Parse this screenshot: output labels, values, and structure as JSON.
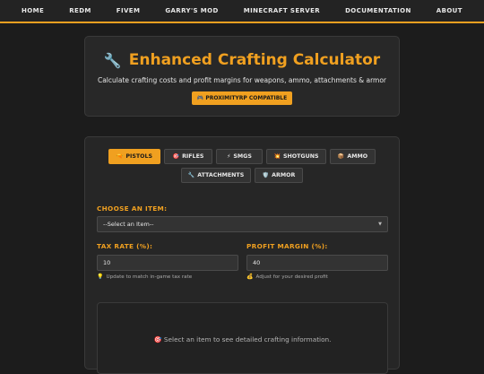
{
  "nav": {
    "items": [
      "HOME",
      "REDM",
      "FIVEM",
      "GARRY'S MOD",
      "MINECRAFT SERVER",
      "DOCUMENTATION",
      "ABOUT"
    ]
  },
  "hero": {
    "icon": "🔧",
    "title": "Enhanced Crafting Calculator",
    "subtitle": "Calculate crafting costs and profit margins for weapons, ammo, attachments & armor",
    "badge_icon": "🎮",
    "badge": "PROXIMITYRP COMPATIBLE"
  },
  "tabs": [
    {
      "icon": "🔫",
      "label": "PISTOLS",
      "active": true
    },
    {
      "icon": "🎯",
      "label": "RIFLES"
    },
    {
      "icon": "⚡",
      "label": "SMGS"
    },
    {
      "icon": "💥",
      "label": "SHOTGUNS"
    },
    {
      "icon": "📦",
      "label": "AMMO"
    },
    {
      "icon": "🔧",
      "label": "ATTACHMENTS"
    },
    {
      "icon": "🛡️",
      "label": "ARMOR"
    }
  ],
  "form": {
    "item_label": "CHOOSE AN ITEM:",
    "item_value": "--Select an Item--",
    "tax_label": "TAX RATE (%):",
    "tax_value": "10",
    "tax_hint_icon": "💡",
    "tax_hint": "Update to match in-game tax rate",
    "profit_label": "PROFIT MARGIN (%):",
    "profit_value": "40",
    "profit_hint_icon": "💰",
    "profit_hint": "Adjust for your desired profit"
  },
  "info": {
    "icon": "🎯",
    "message": "Select an item to see detailed crafting information."
  },
  "colors": {
    "accent": "#f0a020",
    "background": "#1c1c1c",
    "panel": "#262626"
  }
}
